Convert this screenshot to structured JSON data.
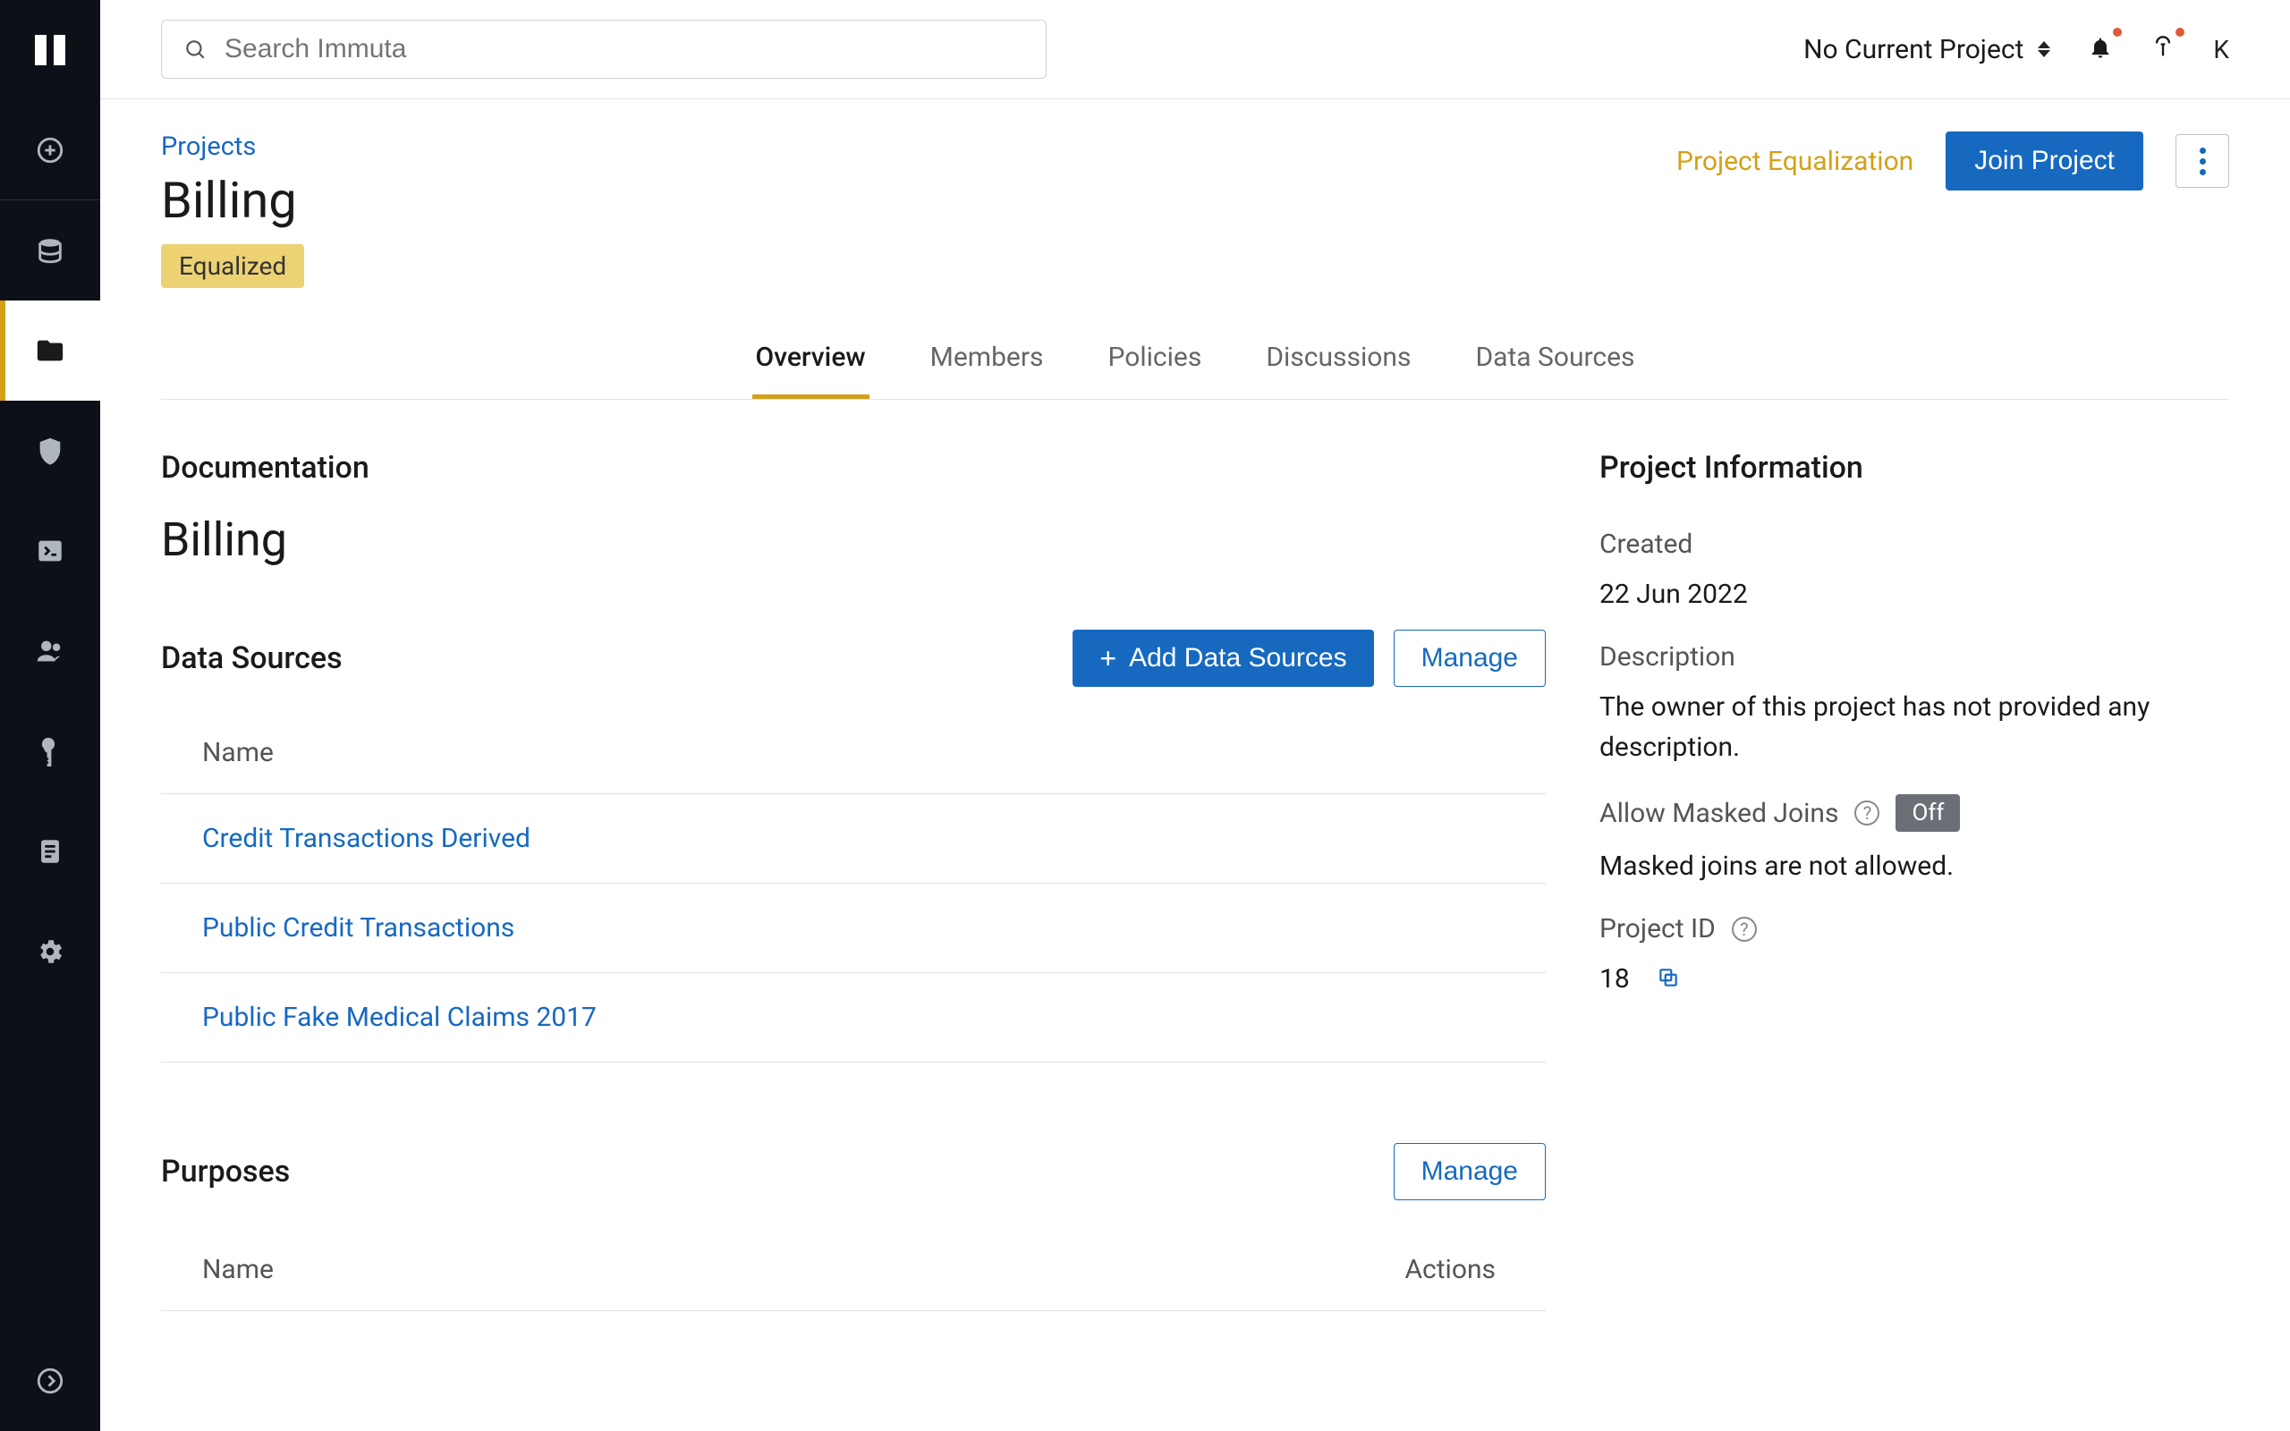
{
  "search": {
    "placeholder": "Search Immuta"
  },
  "topbar": {
    "project_selector": "No Current Project",
    "avatar": "K"
  },
  "breadcrumb": "Projects",
  "project": {
    "title": "Billing",
    "badge": "Equalized"
  },
  "header_actions": {
    "equalization": "Project Equalization",
    "join": "Join Project"
  },
  "tabs": {
    "overview": "Overview",
    "members": "Members",
    "policies": "Policies",
    "discussions": "Discussions",
    "data_sources": "Data Sources"
  },
  "documentation": {
    "heading": "Documentation",
    "title": "Billing"
  },
  "data_sources": {
    "heading": "Data Sources",
    "add_button": "Add Data Sources",
    "manage_button": "Manage",
    "col_name": "Name",
    "rows": [
      "Credit Transactions Derived",
      "Public Credit Transactions",
      "Public Fake Medical Claims 2017"
    ]
  },
  "purposes": {
    "heading": "Purposes",
    "manage_button": "Manage",
    "col_name": "Name",
    "col_actions": "Actions"
  },
  "info": {
    "heading": "Project Information",
    "created_label": "Created",
    "created_value": "22 Jun 2022",
    "description_label": "Description",
    "description_value": "The owner of this project has not provided any description.",
    "masked_label": "Allow Masked Joins",
    "masked_pill": "Off",
    "masked_value": "Masked joins are not allowed.",
    "pid_label": "Project ID",
    "pid_value": "18"
  }
}
